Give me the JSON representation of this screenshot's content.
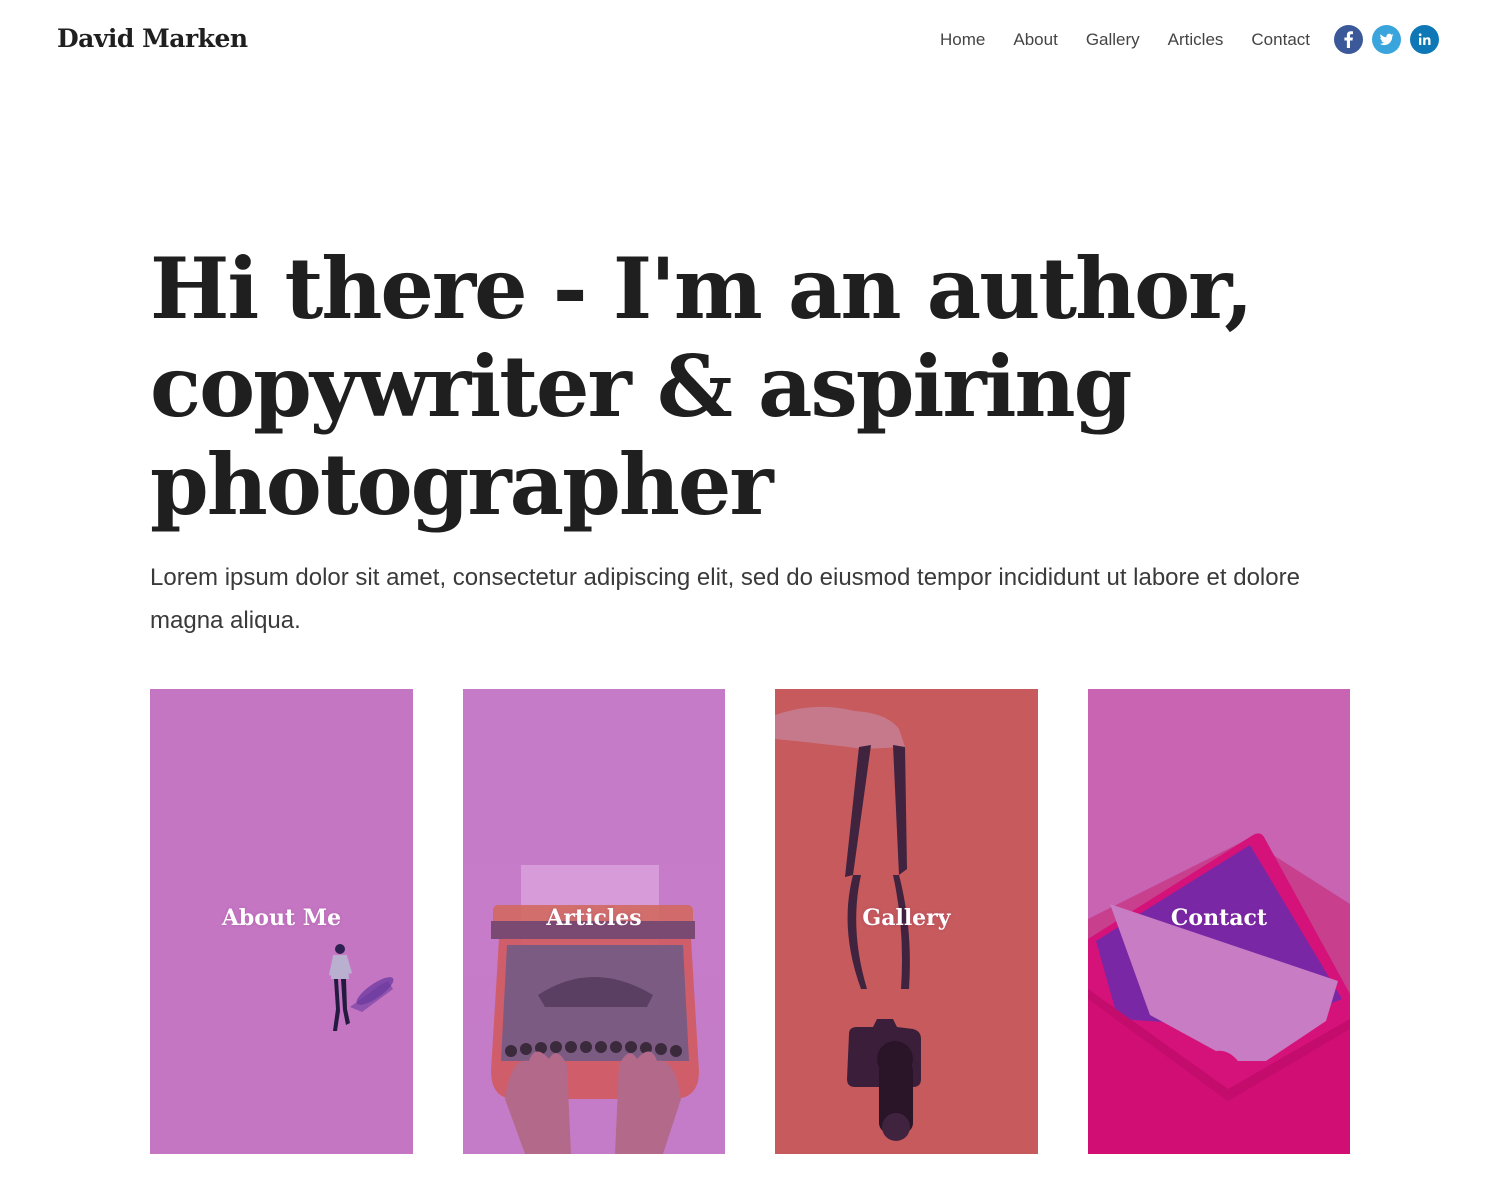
{
  "header": {
    "brand": "David Marken",
    "nav": [
      "Home",
      "About",
      "Gallery",
      "Articles",
      "Contact"
    ],
    "social": [
      {
        "name": "facebook",
        "icon": "facebook-icon",
        "color": "#3b5998"
      },
      {
        "name": "twitter",
        "icon": "twitter-icon",
        "color": "#3aa4dc"
      },
      {
        "name": "linkedin",
        "icon": "linkedin-icon",
        "color": "#0e77b5"
      }
    ]
  },
  "hero": {
    "title": "Hi there - I'm an author, copywriter & aspiring photographer",
    "text": "Lorem ipsum dolor sit amet, consectetur adipiscing elit, sed do eiusmod tempor incididunt ut labore et dolore magna aliqua."
  },
  "cards": [
    {
      "label": "About Me",
      "color": "#c576c3",
      "image": "person-walking-image"
    },
    {
      "label": "Articles",
      "color": "#c67bc8",
      "image": "typewriter-image"
    },
    {
      "label": "Gallery",
      "color": "#c65a5c",
      "image": "camera-image"
    },
    {
      "label": "Contact",
      "color": "#c864b2",
      "image": "envelope-image"
    }
  ]
}
